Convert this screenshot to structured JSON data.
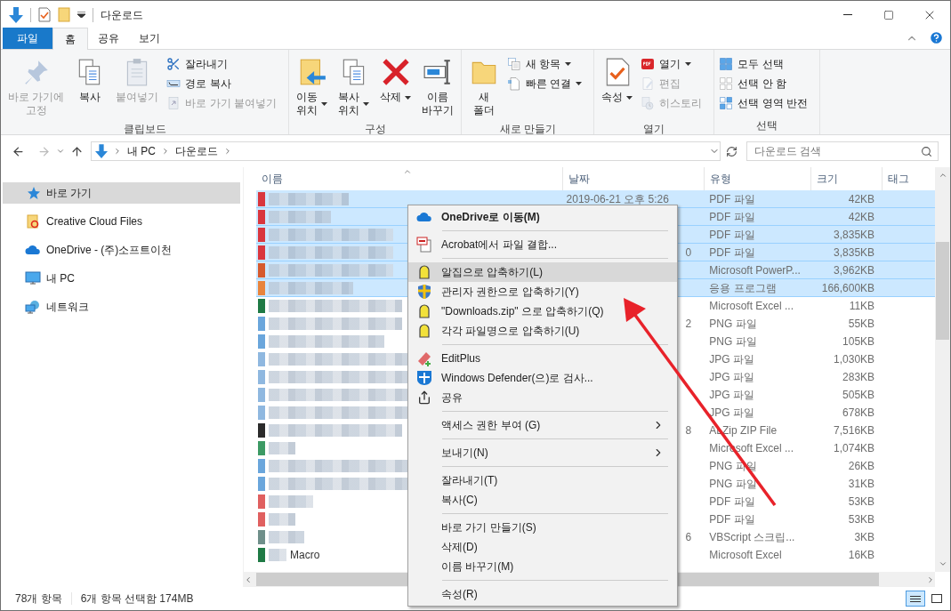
{
  "window": {
    "title": "다운로드"
  },
  "ribbon_tabs": [
    {
      "label": "파일",
      "kind": "file",
      "selected": false
    },
    {
      "label": "홈",
      "kind": "tab",
      "selected": true
    },
    {
      "label": "공유",
      "kind": "tab",
      "selected": false
    },
    {
      "label": "보기",
      "kind": "tab",
      "selected": false
    }
  ],
  "ribbon_groups": [
    {
      "label": "클립보드",
      "big": [
        {
          "label": "바로 가기에\n고정",
          "disabled": true,
          "dropdown": false
        },
        {
          "label": "복사",
          "disabled": false,
          "dropdown": false
        },
        {
          "label": "붙여넣기",
          "disabled": true,
          "dropdown": false
        }
      ],
      "small": [
        {
          "label": "잘라내기",
          "disabled": false,
          "dropdown": false
        },
        {
          "label": "경로 복사",
          "disabled": false,
          "dropdown": false
        },
        {
          "label": "바로 가기 붙여넣기",
          "disabled": true,
          "dropdown": false
        }
      ]
    },
    {
      "label": "구성",
      "big": [
        {
          "label": "이동\n위치",
          "disabled": false,
          "dropdown": true
        },
        {
          "label": "복사\n위치",
          "disabled": false,
          "dropdown": true
        },
        {
          "label": "삭제",
          "disabled": false,
          "dropdown": true
        },
        {
          "label": "이름\n바꾸기",
          "disabled": false,
          "dropdown": false
        }
      ]
    },
    {
      "label": "새로 만들기",
      "big": [
        {
          "label": "새\n폴더",
          "disabled": false,
          "dropdown": false
        }
      ],
      "small": [
        {
          "label": "새 항목",
          "disabled": false,
          "dropdown": true
        },
        {
          "label": "빠른 연결",
          "disabled": false,
          "dropdown": true
        }
      ]
    },
    {
      "label": "열기",
      "big": [
        {
          "label": "속성",
          "disabled": false,
          "dropdown": true
        }
      ],
      "small": [
        {
          "label": "열기",
          "disabled": false,
          "dropdown": true
        },
        {
          "label": "편집",
          "disabled": true,
          "dropdown": false
        },
        {
          "label": "히스토리",
          "disabled": true,
          "dropdown": false
        }
      ]
    },
    {
      "label": "선택",
      "small": [
        {
          "label": "모두 선택",
          "disabled": false,
          "dropdown": false
        },
        {
          "label": "선택 안 함",
          "disabled": false,
          "dropdown": false
        },
        {
          "label": "선택 영역 반전",
          "disabled": false,
          "dropdown": false
        }
      ]
    }
  ],
  "address": {
    "path": [
      "내 PC",
      "다운로드"
    ]
  },
  "search": {
    "placeholder": "다운로드 검색"
  },
  "sidebar": {
    "items": [
      {
        "label": "바로 가기",
        "selected": true
      },
      {
        "label": "Creative Cloud Files",
        "selected": false
      },
      {
        "label": "OneDrive - (주)소프트이천",
        "selected": false
      },
      {
        "label": "내 PC",
        "selected": false
      },
      {
        "label": "네트워크",
        "selected": false
      }
    ]
  },
  "table": {
    "columns": [
      "이름",
      "날짜",
      "유형",
      "크기",
      "태그"
    ],
    "rows": [
      {
        "date": "2019-06-21 오후 5:26",
        "type": "PDF 파일",
        "size": "42KB",
        "selected": true,
        "color": "#d9363e"
      },
      {
        "type": "PDF 파일",
        "size": "42KB",
        "selected": true,
        "color": "#d9363e"
      },
      {
        "type": "PDF 파일",
        "size": "3,835KB",
        "selected": true,
        "color": "#d9363e"
      },
      {
        "date": "0",
        "date_cut": true,
        "type": "PDF 파일",
        "size": "3,835KB",
        "selected": true,
        "color": "#d9363e"
      },
      {
        "type": "Microsoft PowerP...",
        "size": "3,962KB",
        "selected": true,
        "color": "#d65a2e"
      },
      {
        "type": "응용 프로그램",
        "size": "166,600KB",
        "selected": true,
        "color": "#e8843c"
      },
      {
        "type": "Microsoft Excel ...",
        "size": "11KB",
        "selected": false,
        "color": "#1f7a45"
      },
      {
        "date": "2",
        "date_cut": true,
        "type": "PNG 파일",
        "size": "55KB",
        "selected": false,
        "color": "#6aa6dc"
      },
      {
        "type": "PNG 파일",
        "size": "105KB",
        "selected": false,
        "color": "#6aa6dc"
      },
      {
        "type": "JPG 파일",
        "size": "1,030KB",
        "selected": false,
        "color": "#8fb8e0"
      },
      {
        "type": "JPG 파일",
        "size": "283KB",
        "selected": false,
        "color": "#8fb8e0"
      },
      {
        "type": "JPG 파일",
        "size": "505KB",
        "selected": false,
        "color": "#8fb8e0"
      },
      {
        "type": "JPG 파일",
        "size": "678KB",
        "selected": false,
        "color": "#8fb8e0"
      },
      {
        "date": "8",
        "date_cut": true,
        "type": "ALZip ZIP File",
        "size": "7,516KB",
        "selected": false,
        "color": "#2b2b2b"
      },
      {
        "type": "Microsoft Excel ...",
        "size": "1,074KB",
        "selected": false,
        "color": "#3c9a64"
      },
      {
        "type": "PNG 파일",
        "size": "26KB",
        "selected": false,
        "color": "#6aa6dc"
      },
      {
        "type": "PNG 파일",
        "size": "31KB",
        "selected": false,
        "color": "#6aa6dc"
      },
      {
        "type": "PDF 파일",
        "size": "53KB",
        "selected": false,
        "color": "#e06060"
      },
      {
        "type": "PDF 파일",
        "size": "53KB",
        "selected": false,
        "color": "#e06060"
      },
      {
        "date": "6",
        "date_cut": true,
        "type": "VBScript 스크립...",
        "size": "3KB",
        "selected": false,
        "color": "#6f8f8a"
      },
      {
        "name": "Macro",
        "type": "Microsoft Excel",
        "size": "16KB",
        "selected": false,
        "color": "#1f7a45"
      }
    ]
  },
  "context_menu": {
    "items": [
      {
        "kind": "item",
        "label": "OneDrive로 이동(M)",
        "bold": true,
        "highlighted": false,
        "submenu": false
      },
      {
        "kind": "separator"
      },
      {
        "kind": "item",
        "label": "Acrobat에서 파일 결합...",
        "bold": false,
        "highlighted": false,
        "submenu": false
      },
      {
        "kind": "separator"
      },
      {
        "kind": "item",
        "label": "알집으로 압축하기(L)",
        "bold": false,
        "highlighted": true,
        "submenu": false
      },
      {
        "kind": "item",
        "label": "관리자 권한으로 압축하기(Y)",
        "bold": false,
        "highlighted": false,
        "submenu": false
      },
      {
        "kind": "item",
        "label": "\"Downloads.zip\" 으로 압축하기(Q)",
        "bold": false,
        "highlighted": false,
        "submenu": false
      },
      {
        "kind": "item",
        "label": "각각 파일명으로 압축하기(U)",
        "bold": false,
        "highlighted": false,
        "submenu": false
      },
      {
        "kind": "separator"
      },
      {
        "kind": "item",
        "label": "EditPlus",
        "bold": false,
        "highlighted": false,
        "submenu": false
      },
      {
        "kind": "item",
        "label": "Windows Defender(으)로 검사...",
        "bold": false,
        "highlighted": false,
        "submenu": false
      },
      {
        "kind": "item",
        "label": "공유",
        "bold": false,
        "highlighted": false,
        "submenu": false
      },
      {
        "kind": "separator"
      },
      {
        "kind": "item",
        "label": "액세스 권한 부여 (G)",
        "bold": false,
        "highlighted": false,
        "submenu": true
      },
      {
        "kind": "separator"
      },
      {
        "kind": "item",
        "label": "보내기(N)",
        "bold": false,
        "highlighted": false,
        "submenu": true
      },
      {
        "kind": "separator"
      },
      {
        "kind": "item",
        "label": "잘라내기(T)",
        "bold": false,
        "highlighted": false,
        "submenu": false
      },
      {
        "kind": "item",
        "label": "복사(C)",
        "bold": false,
        "highlighted": false,
        "submenu": false
      },
      {
        "kind": "separator"
      },
      {
        "kind": "item",
        "label": "바로 가기 만들기(S)",
        "bold": false,
        "highlighted": false,
        "submenu": false
      },
      {
        "kind": "item",
        "label": "삭제(D)",
        "bold": false,
        "highlighted": false,
        "submenu": false
      },
      {
        "kind": "item",
        "label": "이름 바꾸기(M)",
        "bold": false,
        "highlighted": false,
        "submenu": false
      },
      {
        "kind": "separator"
      },
      {
        "kind": "item",
        "label": "속성(R)",
        "bold": false,
        "highlighted": false,
        "submenu": false
      }
    ]
  },
  "status_bar": {
    "count": "78개 항목",
    "selection": "6개 항목 선택함 174MB"
  }
}
